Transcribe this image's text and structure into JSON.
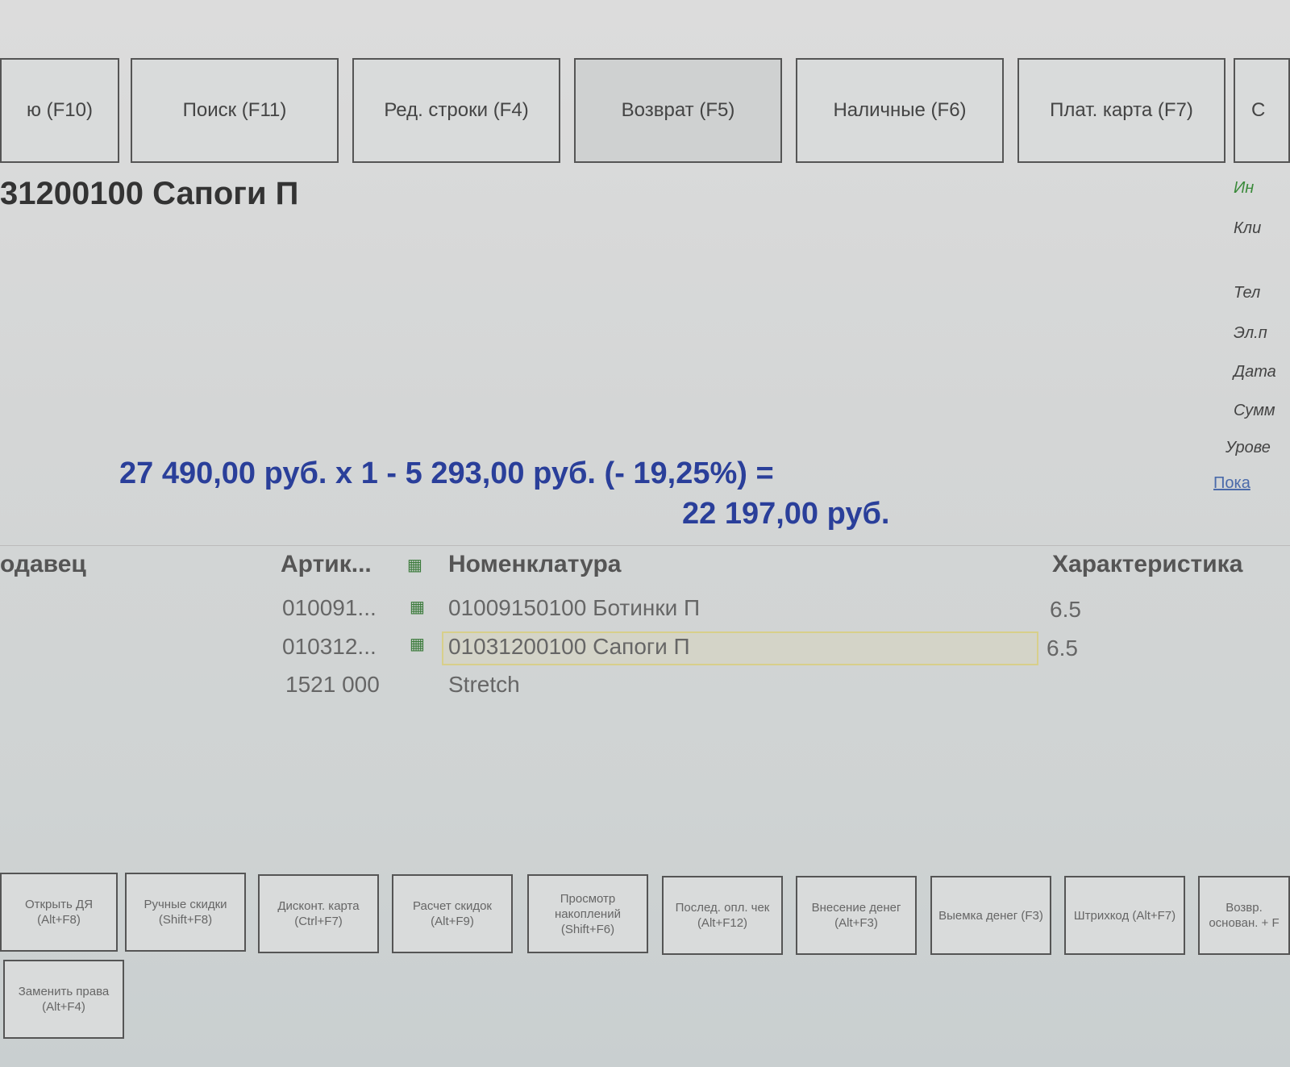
{
  "top_buttons": [
    "ю (F10)",
    "Поиск (F11)",
    "Ред. строки (F4)",
    "Возврат (F5)",
    "Наличные (F6)",
    "Плат. карта (F7)",
    "С"
  ],
  "item_title": "31200100 Сапоги П",
  "right_panel": [
    "Ин",
    "Кли",
    "Тел",
    "Эл.п",
    "Дата",
    "Сумм",
    "Урове",
    "Пока"
  ],
  "price_line": "27 490,00 руб. х 1  - 5 293,00 руб. (- 19,25%) =",
  "total": "22 197,00 руб.",
  "table": {
    "headers": [
      "одавец",
      "Артик...",
      "Номенклатура",
      "Характеристика"
    ],
    "rows": [
      {
        "article": "010091...",
        "name": "01009150100 Ботинки П",
        "char": "6.5"
      },
      {
        "article": "010312...",
        "name": "01031200100 Сапоги П",
        "char": "6.5",
        "selected": true
      },
      {
        "article": "1521 000",
        "name": "Stretch",
        "char": ""
      }
    ]
  },
  "bottom_buttons": [
    "Открыть ДЯ (Alt+F8)",
    "Ручные скидки (Shift+F8)",
    "Дисконт. карта (Ctrl+F7)",
    "Расчет скидок (Alt+F9)",
    "Просмотр накоплений (Shift+F6)",
    "Послед. опл. чек (Alt+F12)",
    "Внесение денег (Alt+F3)",
    "Выемка денег (F3)",
    "Штрихкод (Alt+F7)",
    "Возвр. основан. + F",
    "Заменить права (Alt+F4)"
  ],
  "colors": {
    "price": "#2a3f9a",
    "link": "#3a7a3a"
  }
}
